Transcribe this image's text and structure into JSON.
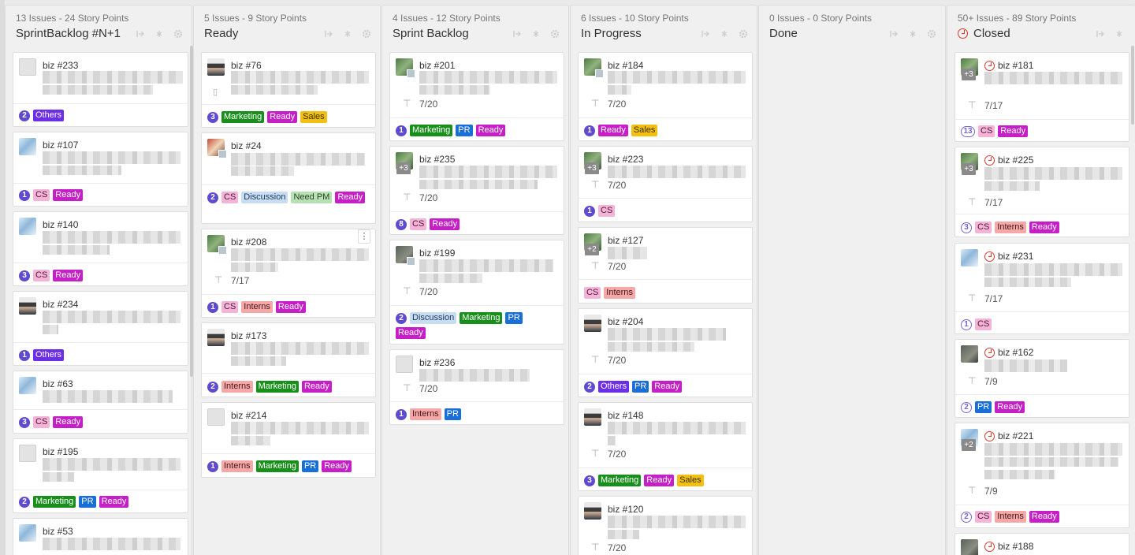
{
  "columns": [
    {
      "meta": "13 Issues - 24 Story Points",
      "title": "SprintBacklog #N+1",
      "cards": [
        {
          "number": "biz #233",
          "points": "2",
          "labels": [
            "Others"
          ]
        },
        {
          "number": "biz #107",
          "points": "1",
          "labels": [
            "CS",
            "Ready"
          ]
        },
        {
          "number": "biz #140",
          "points": "3",
          "labels": [
            "CS",
            "Ready"
          ]
        },
        {
          "number": "biz #234",
          "points": "1",
          "labels": [
            "Others"
          ]
        },
        {
          "number": "biz #63",
          "points": "3",
          "labels": [
            "CS",
            "Ready"
          ]
        },
        {
          "number": "biz #195",
          "points": "2",
          "labels": [
            "Marketing",
            "PR",
            "Ready"
          ]
        },
        {
          "number": "biz #53",
          "points": "",
          "labels": []
        }
      ]
    },
    {
      "meta": "5 Issues - 9 Story Points",
      "title": "Ready",
      "cards": [
        {
          "number": "biz #76",
          "points": "3",
          "labels": [
            "Marketing",
            "Ready",
            "Sales"
          ]
        },
        {
          "number": "biz #24",
          "points": "2",
          "labels": [
            "CS",
            "Discussion",
            "Need PM",
            "Ready"
          ]
        },
        {
          "number": "biz #208",
          "date": "7/17",
          "points": "1",
          "labels": [
            "CS",
            "Interns",
            "Ready"
          ]
        },
        {
          "number": "biz #173",
          "points": "2",
          "labels": [
            "Interns",
            "Marketing",
            "Ready"
          ]
        },
        {
          "number": "biz #214",
          "points": "1",
          "labels": [
            "Interns",
            "Marketing",
            "PR",
            "Ready"
          ]
        }
      ]
    },
    {
      "meta": "4 Issues - 12 Story Points",
      "title": "Sprint Backlog",
      "cards": [
        {
          "number": "biz #201",
          "date": "7/20",
          "points": "1",
          "labels": [
            "Marketing",
            "PR",
            "Ready"
          ]
        },
        {
          "number": "biz #235",
          "more": "+3",
          "date": "7/20",
          "points": "8",
          "labels": [
            "CS",
            "Ready"
          ]
        },
        {
          "number": "biz #199",
          "date": "7/20",
          "points": "2",
          "labels": [
            "Discussion",
            "Marketing",
            "PR",
            "Ready"
          ]
        },
        {
          "number": "biz #236",
          "date": "7/20",
          "points": "1",
          "labels": [
            "Interns",
            "PR"
          ]
        }
      ]
    },
    {
      "meta": "6 Issues - 10 Story Points",
      "title": "In Progress",
      "cards": [
        {
          "number": "biz #184",
          "date": "7/20",
          "points": "1",
          "labels": [
            "Ready",
            "Sales"
          ]
        },
        {
          "number": "biz #223",
          "more": "+3",
          "date": "7/20",
          "points": "1",
          "labels": [
            "CS"
          ]
        },
        {
          "number": "biz #127",
          "more": "+2",
          "date": "7/20",
          "points": "",
          "labels": [
            "CS",
            "Interns"
          ]
        },
        {
          "number": "biz #204",
          "date": "7/20",
          "points": "2",
          "labels": [
            "Others",
            "PR",
            "Ready"
          ]
        },
        {
          "number": "biz #148",
          "date": "7/20",
          "points": "3",
          "labels": [
            "Marketing",
            "Ready",
            "Sales"
          ]
        },
        {
          "number": "biz #120",
          "date": "7/20",
          "points": "",
          "labels": []
        }
      ]
    },
    {
      "meta": "0 Issues - 0 Story Points",
      "title": "Done",
      "cards": []
    },
    {
      "meta": "50+ Issues - 89 Story Points",
      "title": "Closed",
      "cards": [
        {
          "number": "biz #181",
          "more": "+3",
          "date": "7/17",
          "points": "13",
          "labels": [
            "CS",
            "Ready"
          ]
        },
        {
          "number": "biz #225",
          "more": "+3",
          "date": "7/17",
          "points": "3",
          "labels": [
            "CS",
            "Interns",
            "Ready"
          ]
        },
        {
          "number": "biz #231",
          "date": "7/17",
          "points": "1",
          "labels": [
            "CS"
          ]
        },
        {
          "number": "biz #162",
          "date": "7/9",
          "points": "2",
          "labels": [
            "PR",
            "Ready"
          ]
        },
        {
          "number": "biz #221",
          "more": "+2",
          "date": "7/9",
          "points": "2",
          "labels": [
            "CS",
            "Interns",
            "Ready"
          ]
        },
        {
          "number": "biz #188",
          "points": "",
          "labels": []
        }
      ]
    }
  ]
}
